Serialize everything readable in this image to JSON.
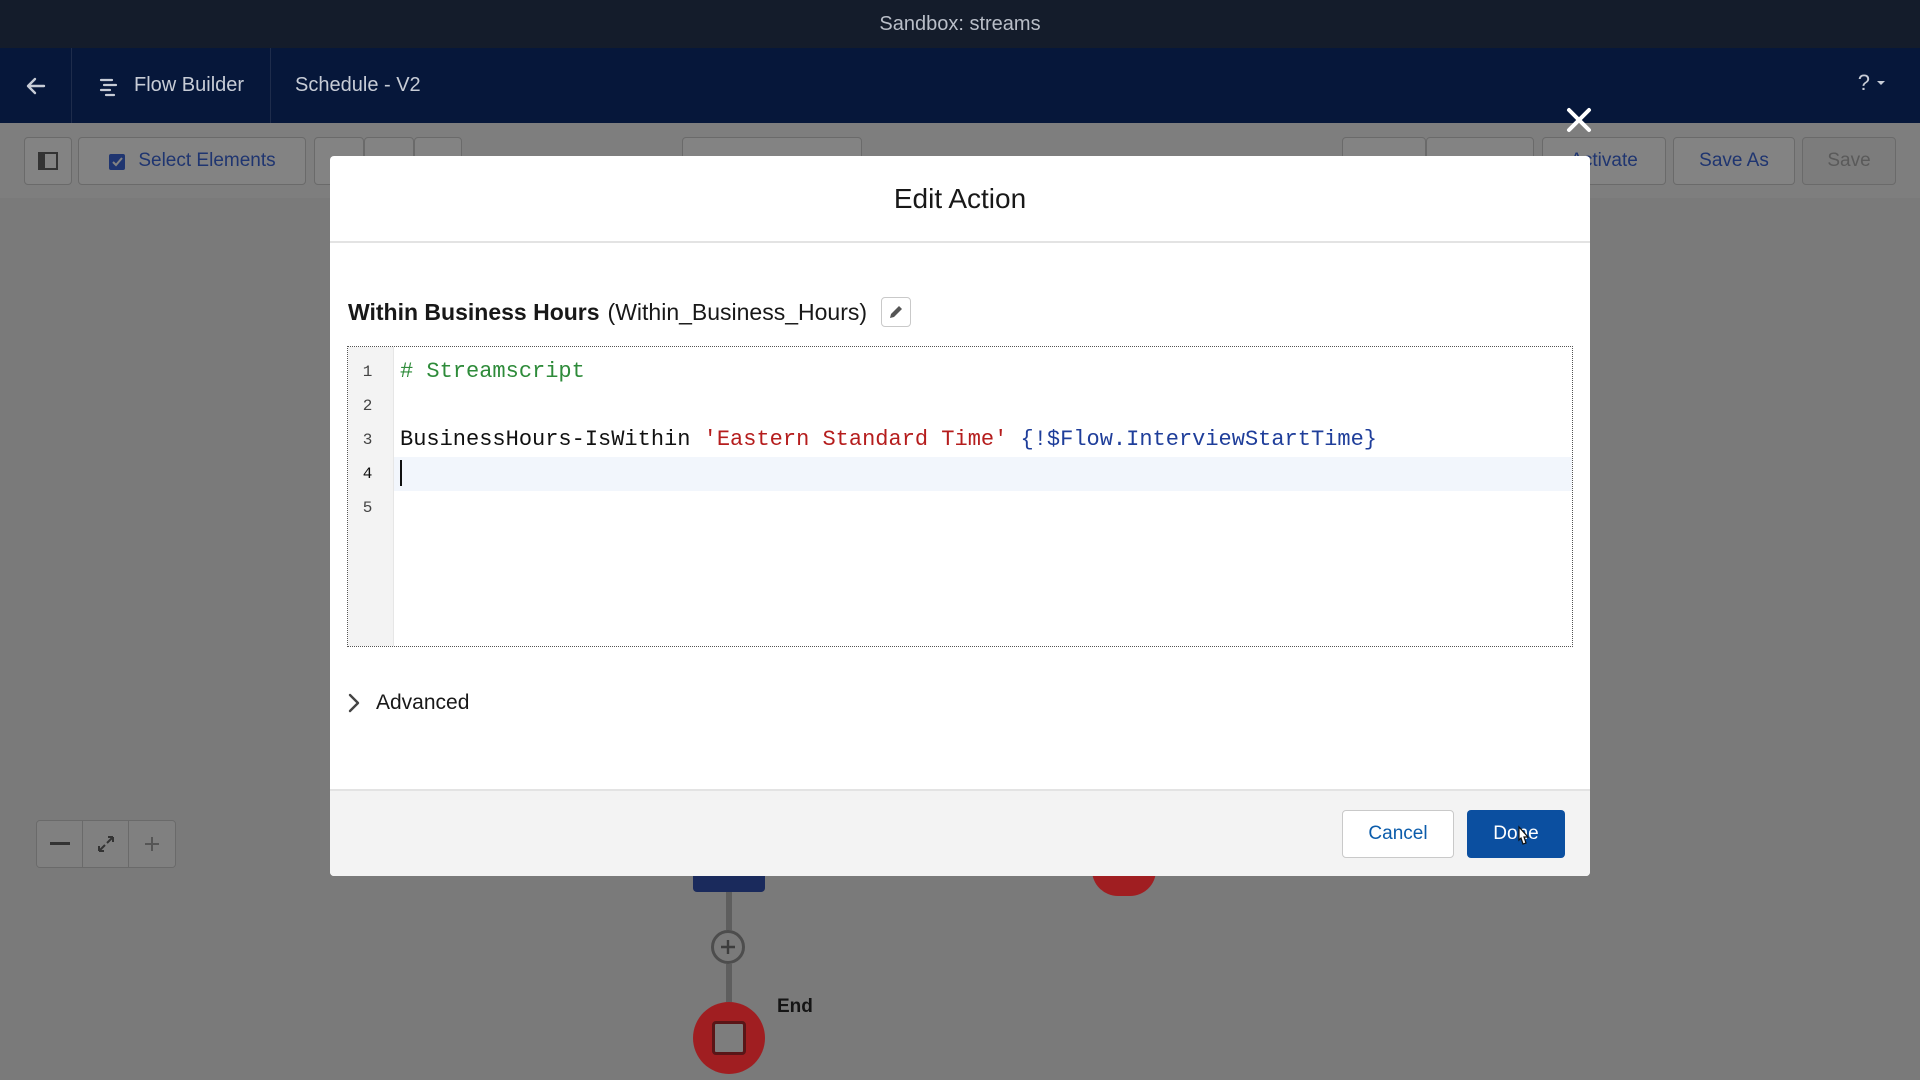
{
  "window": {
    "title": "Sandbox: streams"
  },
  "header": {
    "app_name": "Flow Builder",
    "flow_name": "Schedule - V2",
    "help_label": "?"
  },
  "toolbar": {
    "select_elements_label": "Select Elements",
    "activate_label": "Activate",
    "save_as_label": "Save As",
    "save_label": "Save"
  },
  "canvas": {
    "end_label": "End"
  },
  "modal": {
    "title": "Edit Action",
    "action_label": "Within Business Hours",
    "action_api_name": "(Within_Business_Hours)",
    "code_lines": [
      {
        "number": "1",
        "comment": "# Streamscript"
      },
      {
        "number": "2"
      },
      {
        "number": "3",
        "keyword": "BusinessHours-IsWithin ",
        "string": "'Eastern Standard Time'",
        "variable": " {!$Flow.InterviewStartTime}"
      },
      {
        "number": "4"
      },
      {
        "number": "5"
      }
    ],
    "advanced_label": "Advanced",
    "cancel_label": "Cancel",
    "done_label": "Done"
  },
  "icons": {
    "back": "back-arrow-icon",
    "app": "flow-icon",
    "close": "close-icon",
    "edit": "pencil-icon",
    "chevron": "chevron-right-icon"
  },
  "colors": {
    "header_bg": "#06173a",
    "primary": "#0b4fa0",
    "link": "#0b5cab",
    "comment": "#2e8b3a",
    "string": "#b51d1d",
    "variable": "#1f3e9a"
  }
}
